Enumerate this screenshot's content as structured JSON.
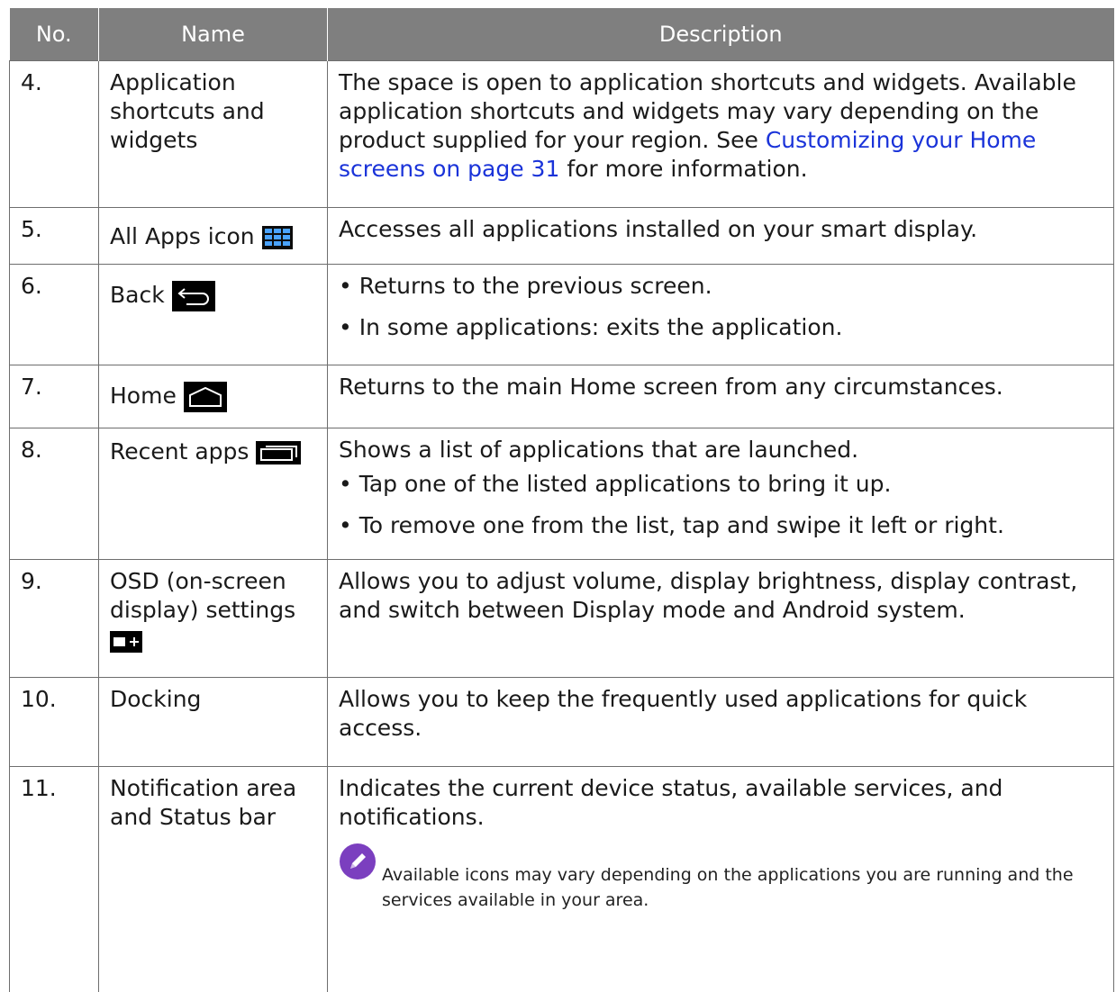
{
  "header": {
    "col_no": "No.",
    "col_name": "Name",
    "col_description": "Description"
  },
  "rows": [
    {
      "no": "4.",
      "name": "Application shortcuts and widgets",
      "description": {
        "text_before": "The space is open to application shortcuts and widgets. Available application shortcuts and widgets may vary depending on the product supplied for your region. See ",
        "link": "Customizing your Home screens on page 31",
        "text_after": " for more information."
      }
    },
    {
      "no": "5.",
      "name": "All Apps icon",
      "icon": "all-apps-icon",
      "description": "Accesses all applications installed on your smart display."
    },
    {
      "no": "6.",
      "name": "Back",
      "icon": "back-icon",
      "bullets": [
        "• Returns to the previous screen.",
        "• In some applications: exits the application."
      ]
    },
    {
      "no": "7.",
      "name": "Home",
      "icon": "home-icon",
      "description": "Returns to the main Home screen from any circumstances."
    },
    {
      "no": "8.",
      "name": "Recent apps",
      "icon": "recent-apps-icon",
      "description": "Shows a list of applications that are launched.",
      "bullets": [
        "• Tap one of the listed applications to bring it up.",
        "• To remove one from the list, tap and swipe it left or right."
      ]
    },
    {
      "no": "9.",
      "name": "OSD (on-screen display) settings",
      "icon": "osd-settings-icon",
      "description": "Allows you to adjust volume, display brightness, display contrast, and switch between Display mode and Android system."
    },
    {
      "no": "10.",
      "name": "Docking",
      "description": "Allows you to keep the frequently used applications for quick access."
    },
    {
      "no": "11.",
      "name": "Notification area and Status bar",
      "description": "Indicates the current device status, available services, and notifications.",
      "note": "Available icons may vary depending on the applications you are running and the services available in your area.",
      "note_icon": "pencil-note-icon"
    }
  ],
  "colors": {
    "header_bg": "#7f7f7f",
    "link": "#1a33d9",
    "note_icon": "#7b3fbf"
  }
}
